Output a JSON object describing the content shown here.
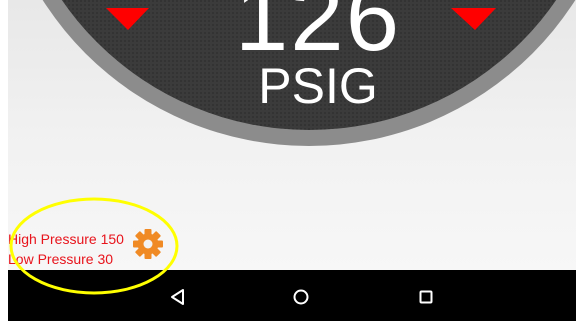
{
  "gauge": {
    "value": "126",
    "unit": "PSIG"
  },
  "settings": {
    "high_pressure_label": "High Pressure 150",
    "low_pressure_label": "Low Pressure 30"
  },
  "navbar": {
    "back_icon": "back-triangle-icon",
    "home_icon": "home-circle-icon",
    "recents_icon": "recents-square-icon"
  },
  "colors": {
    "gauge_face": "#3a3a3a",
    "gauge_rim": "#8a8a8a",
    "marker": "#ff0000",
    "pressure_text": "#e8141c",
    "gear": "#f08a24",
    "annotation": "#ffff00",
    "navbar": "#000000"
  }
}
